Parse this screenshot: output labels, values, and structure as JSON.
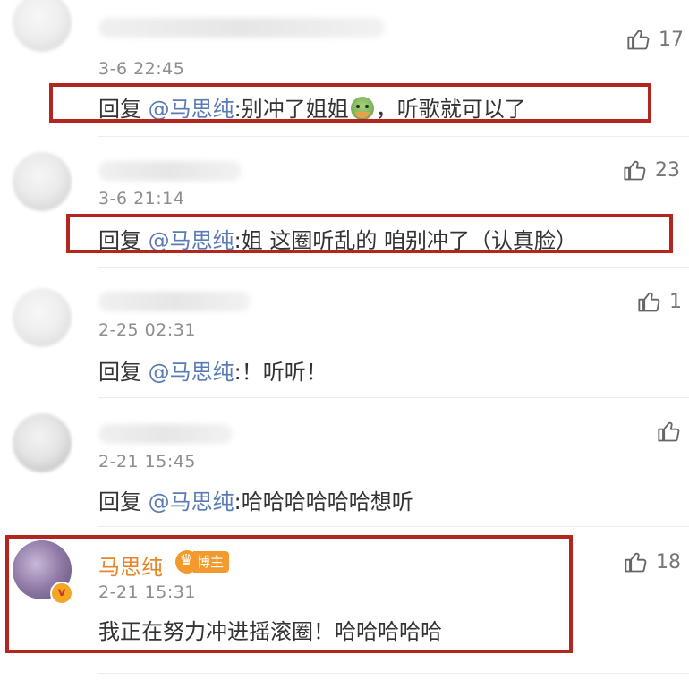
{
  "comments": [
    {
      "time": "3-6 22:45",
      "reply_prefix": "回复 ",
      "mention": "@马思纯",
      "text_a": ":别冲了姐姐",
      "text_b": "，听歌就可以了",
      "likes": "17"
    },
    {
      "time": "3-6 21:14",
      "reply_prefix": "回复 ",
      "mention": "@马思纯",
      "text": ":姐  这圈听乱的  咱别冲了（认真脸）",
      "likes": "23"
    },
    {
      "time": "2-25 02:31",
      "reply_prefix": "回复 ",
      "mention": "@马思纯",
      "text": ":！听听！",
      "likes": "1"
    },
    {
      "time": "2-21 15:45",
      "reply_prefix": "回复 ",
      "mention": "@马思纯",
      "text": ":哈哈哈哈哈哈想听",
      "likes": ""
    }
  ],
  "host_comment": {
    "name": "马思纯",
    "badge": "博主",
    "verified": "v",
    "time": "2-21 15:31",
    "text": "我正在努力冲进摇滚圈！哈哈哈哈哈",
    "likes": "18"
  },
  "icons": {
    "like": "thumbs-up-icon",
    "emoji": "green-face-emoji-icon",
    "crown": "crown-icon",
    "verified": "verified-v-icon"
  },
  "colors": {
    "highlight_box": "#b3261e",
    "mention": "#5a7bb5",
    "host_name": "#e8842a"
  }
}
